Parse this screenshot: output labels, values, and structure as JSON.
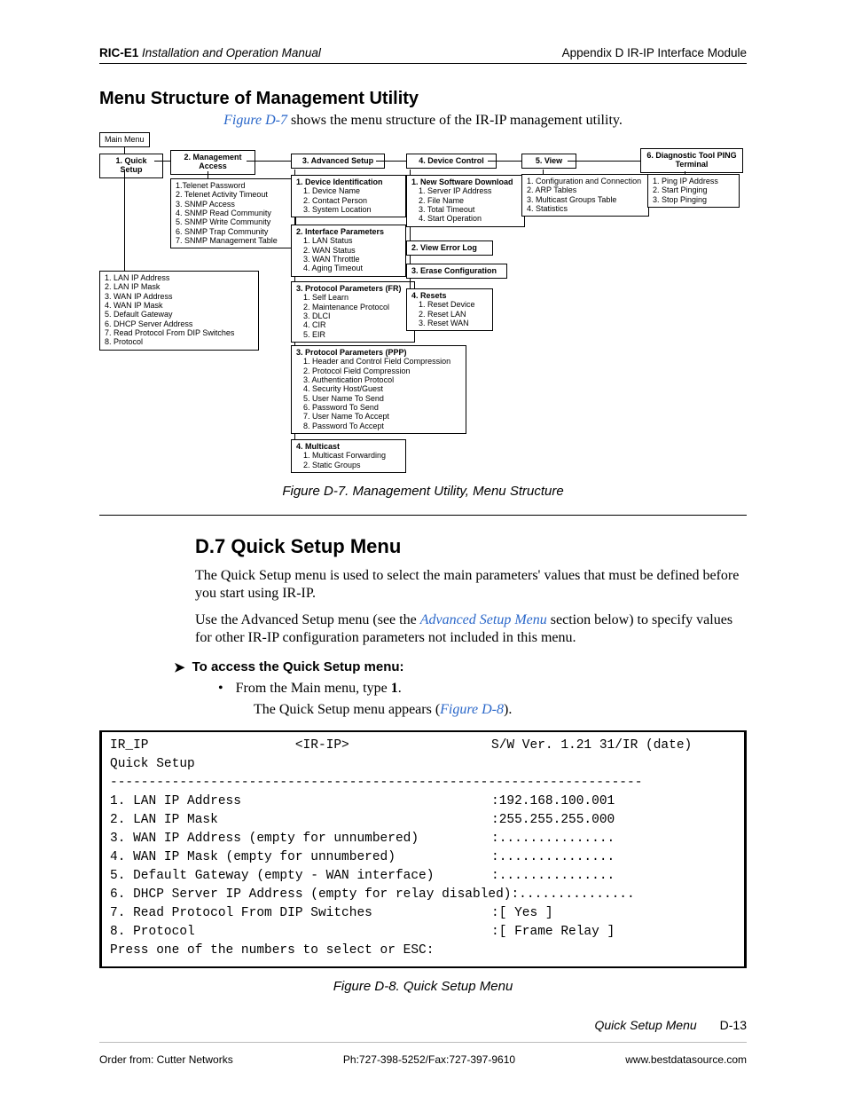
{
  "header": {
    "left_bold": "RIC-E1",
    "left_rest": " Installation and Operation Manual",
    "right": "Appendix D  IR-IP Interface Module"
  },
  "sec1": {
    "title": "Menu Structure of Management Utility",
    "intro_pre": "Figure D-7",
    "intro_post": " shows the menu structure of the IR-IP management utility."
  },
  "diagram": {
    "main": "Main Menu",
    "n1": {
      "title": "1. Quick Setup"
    },
    "n1_items": [
      "1. LAN IP Address",
      "2. LAN IP Mask",
      "3. WAN IP Address",
      "4. WAN IP Mask",
      "5. Default Gateway",
      "6. DHCP Server Address",
      "7. Read Protocol From DIP Switches",
      "8. Protocol"
    ],
    "n2": {
      "title": "2. Management Access"
    },
    "n2_items": [
      "1.Telenet Password",
      "2. Telenet Activity Timeout",
      "3. SNMP Access",
      "4. SNMP Read Community",
      "5. SNMP Write Community",
      "6. SNMP Trap Community",
      "7. SNMP Management Table"
    ],
    "n3": {
      "title": "3. Advanced Setup"
    },
    "n3a": {
      "title": "1. Device Identification",
      "items": [
        "1. Device Name",
        "2. Contact Person",
        "3. System Location"
      ]
    },
    "n3b": {
      "title": "2. Interface Parameters",
      "items": [
        "1. LAN Status",
        "2. WAN Status",
        "3. WAN Throttle",
        "4. Aging Timeout"
      ]
    },
    "n3c": {
      "title": "3. Protocol Parameters (FR)",
      "items": [
        "1. Self Learn",
        "2. Maintenance Protocol",
        "3. DLCI",
        "4. CIR",
        "5. EIR"
      ]
    },
    "n3d": {
      "title": "3. Protocol Parameters (PPP)",
      "items": [
        "1. Header and Control Field Compression",
        "2. Protocol Field Compression",
        "3. Authentication Protocol",
        "4. Security Host/Guest",
        "5. User Name To Send",
        "6. Password To Send",
        "7. User Name To Accept",
        "8. Password To Accept"
      ]
    },
    "n3e": {
      "title": "4. Multicast",
      "items": [
        "1. Multicast Forwarding",
        "2. Static Groups"
      ]
    },
    "n4": {
      "title": "4. Device Control"
    },
    "n4a": {
      "title": "1. New Software Download",
      "items": [
        "1. Server IP Address",
        "2. File Name",
        "3. Total Timeout",
        "4. Start Operation"
      ]
    },
    "n4b": "2. View Error Log",
    "n4c": "3. Erase Configuration",
    "n4d": {
      "title": "4. Resets",
      "items": [
        "1. Reset Device",
        "2. Reset LAN",
        "3. Reset WAN"
      ]
    },
    "n5": {
      "title": "5. View",
      "items": [
        "1. Configuration and Connection",
        "2. ARP Tables",
        "3. Multicast Groups Table",
        "4. Statistics"
      ]
    },
    "n6": {
      "title": "6. Diagnostic Tool PING Terminal",
      "items": [
        "1. Ping IP Address",
        "2. Start Pinging",
        "3. Stop Pinging"
      ]
    }
  },
  "fig_d7": "Figure D-7.  Management Utility, Menu Structure",
  "sec2": {
    "heading": "D.7 Quick Setup Menu",
    "p1": "The Quick Setup menu is used to select the main parameters' values that must be defined before you start using IR-IP.",
    "p2a": "Use the Advanced Setup menu (see the ",
    "p2link": "Advanced Setup Menu",
    "p2b": " section below) to specify values for other IR-IP configuration parameters not included in this menu.",
    "proc": "To access the Quick Setup menu:",
    "bullet": "From the Main menu, type ",
    "bullet_bold": "1",
    "bullet_end": ".",
    "sub_a": "The Quick Setup menu appears (",
    "sub_link": "Figure D-8",
    "sub_b": ")."
  },
  "terminal": {
    "hdr_left": "IR_IP",
    "hdr_mid": "<IR-IP>",
    "hdr_right": "S/W Ver. 1.21 31/IR (date)",
    "sub": "Quick Setup",
    "rule": "---------------------------------------------------------------------",
    "rows": [
      {
        "l": "1. LAN IP Address",
        "r": ":192.168.100.001"
      },
      {
        "l": "2. LAN IP Mask",
        "r": ":255.255.255.000"
      },
      {
        "l": "3. WAN IP Address (empty for unnumbered)",
        "r": ":..............."
      },
      {
        "l": "4. WAN IP Mask (empty for unnumbered)",
        "r": ":..............."
      },
      {
        "l": "5. Default Gateway (empty - WAN interface)",
        "r": ":..............."
      },
      {
        "l": "6. DHCP Server IP Address (empty for relay disabled)",
        "r": ":..............."
      },
      {
        "l": "7. Read Protocol From DIP Switches",
        "r": ":[ Yes ]"
      },
      {
        "l": "8. Protocol",
        "r": ":[ Frame Relay ]"
      }
    ],
    "prompt": "Press one of the numbers to select or ESC:"
  },
  "fig_d8": "Figure D-8.  Quick Setup Menu",
  "footer": {
    "title": "Quick Setup Menu",
    "page": "D-13"
  },
  "order": {
    "left": "Order from: Cutter Networks",
    "mid": "Ph:727-398-5252/Fax:727-397-9610",
    "right": "www.bestdatasource.com"
  }
}
